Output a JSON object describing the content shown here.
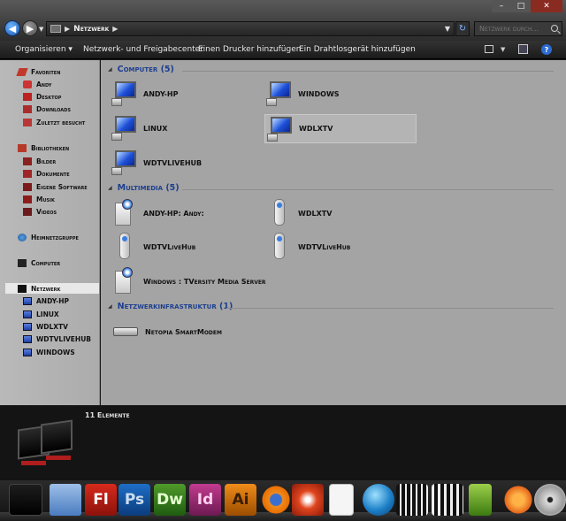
{
  "address": {
    "crumb": "Netzwerk",
    "search_placeholder": "Netzwerk durch..."
  },
  "toolbar": {
    "organize": "Organisieren ▾",
    "share_center": "Netzwerk- und Freigabecenter",
    "add_printer": "Einen Drucker hinzufügen",
    "add_wireless": "Ein Drahtlosgerät hinzufügen"
  },
  "sidebar": {
    "favorites": {
      "title": "Favoriten",
      "items": [
        "Andy",
        "Desktop",
        "Downloads",
        "Zuletzt besucht"
      ]
    },
    "libraries": {
      "title": "Bibliotheken",
      "items": [
        "Bilder",
        "Dokumente",
        "Eigene Software",
        "Musik",
        "Videos"
      ]
    },
    "homegroup": "Heimnetzgruppe",
    "computer": "Computer",
    "network": {
      "title": "Netzwerk",
      "items": [
        "ANDY-HP",
        "LINUX",
        "WDLXTV",
        "WDTVLIVEHUB",
        "WINDOWS"
      ]
    }
  },
  "groups": {
    "computer": {
      "title": "Computer (5)",
      "items": [
        "ANDY-HP",
        "WINDOWS",
        "LINUX",
        "WDLXTV",
        "WDTVLIVEHUB"
      ]
    },
    "multimedia": {
      "title": "Multimedia (5)",
      "items": [
        "ANDY-HP: Andy:",
        "WDLXTV",
        "WDTVLiveHub",
        "WDTVLiveHub",
        "Windows : TVersity Media Server"
      ]
    },
    "infrastructure": {
      "title": "Netzwerkinfrastruktur (1)",
      "items": [
        "Netopia SmartModem"
      ]
    }
  },
  "details": {
    "count": "11 Elemente"
  },
  "dock": {
    "fl": "Fl",
    "ps": "Ps",
    "dw": "Dw",
    "id": "Id",
    "ai": "Ai"
  }
}
